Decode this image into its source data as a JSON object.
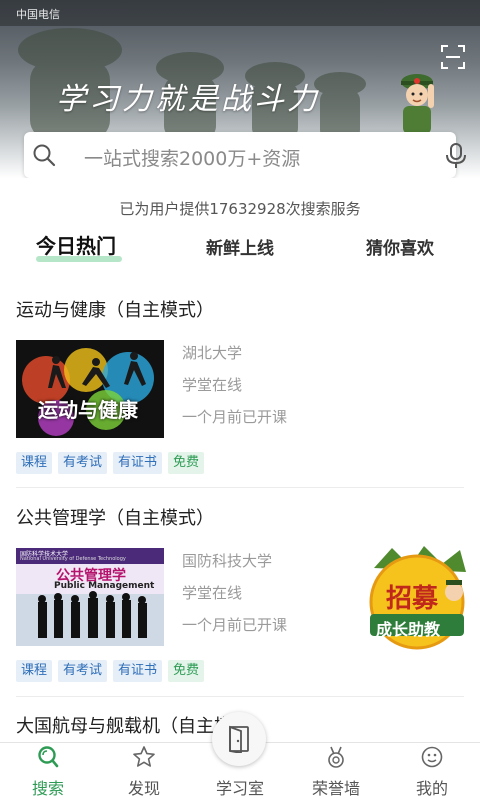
{
  "status_bar": {
    "carrier": "中国电信"
  },
  "hero": {
    "slogan": "学习力就是战斗力",
    "search": {
      "placeholder": "一站式搜索2000万+资源"
    },
    "service_text": "已为用户提供17632928次搜索服务"
  },
  "tabs": [
    {
      "label": "今日热门",
      "active": true
    },
    {
      "label": "新鲜上线",
      "active": false
    },
    {
      "label": "猜你喜欢",
      "active": false
    }
  ],
  "courses": [
    {
      "title": "运动与健康（自主模式）",
      "thumb_text": "运动与健康",
      "university": "湖北大学",
      "platform": "学堂在线",
      "status": "一个月前已开课",
      "tags": [
        "课程",
        "有考试",
        "有证书",
        "免费"
      ]
    },
    {
      "title": "公共管理学（自主模式）",
      "thumb_text": "公共管理学",
      "thumb_subtext": "Public Management",
      "thumb_header": "国防科学技术大学",
      "thumb_header_en": "National University of Defense Technology",
      "university": "国防科技大学",
      "platform": "学堂在线",
      "status": "一个月前已开课",
      "tags": [
        "课程",
        "有考试",
        "有证书",
        "免费"
      ]
    },
    {
      "title": "大国航母与舰载机（自主模式）"
    }
  ],
  "recruit_badge": {
    "line1": "招募",
    "line2": "成长助教"
  },
  "bottom_nav": [
    {
      "label": "搜索",
      "icon": "search-icon",
      "active": true
    },
    {
      "label": "发现",
      "icon": "star-icon",
      "active": false
    },
    {
      "label": "学习室",
      "icon": "door-icon",
      "active": false
    },
    {
      "label": "荣誉墙",
      "icon": "medal-icon",
      "active": false
    },
    {
      "label": "我的",
      "icon": "profile-icon",
      "active": false
    }
  ],
  "colors": {
    "accent_green": "#2e9b55",
    "tag_blue": "#2f6fb8",
    "tab_underline": "#b6e6c8"
  }
}
